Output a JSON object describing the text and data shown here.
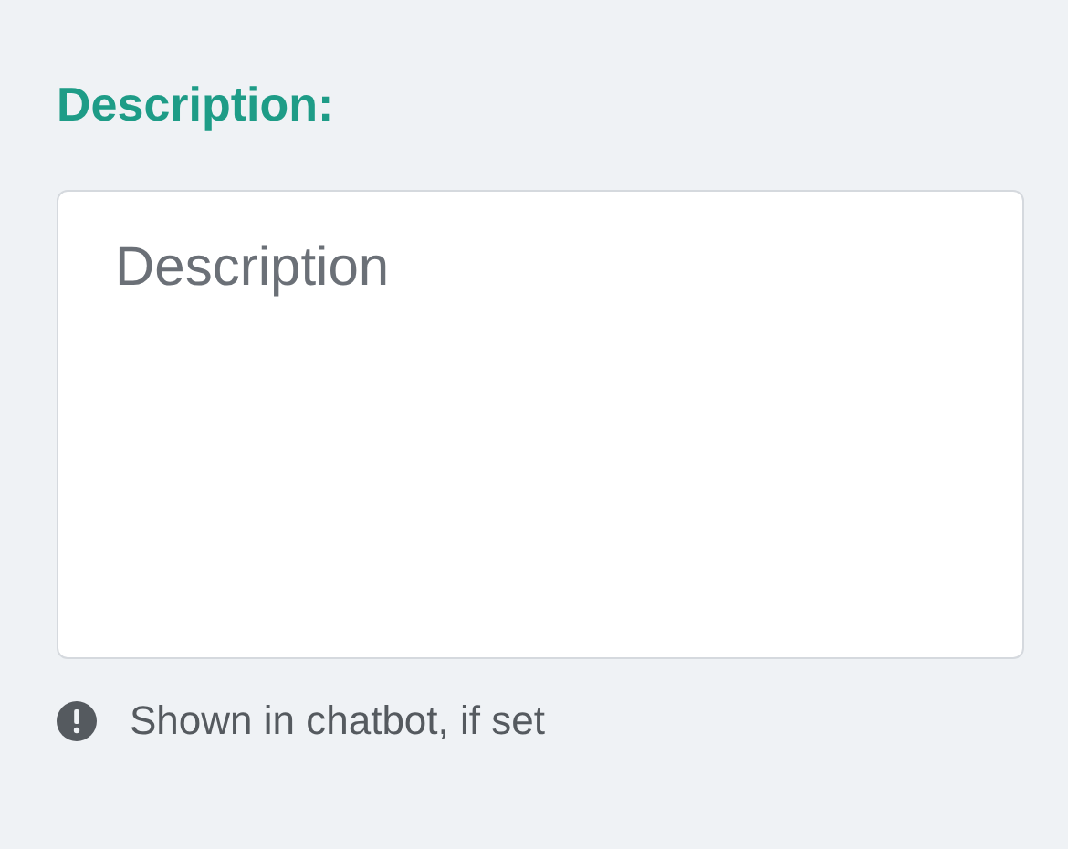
{
  "field": {
    "label": "Description:",
    "placeholder": "Description",
    "hint": "Shown in chatbot, if set"
  }
}
